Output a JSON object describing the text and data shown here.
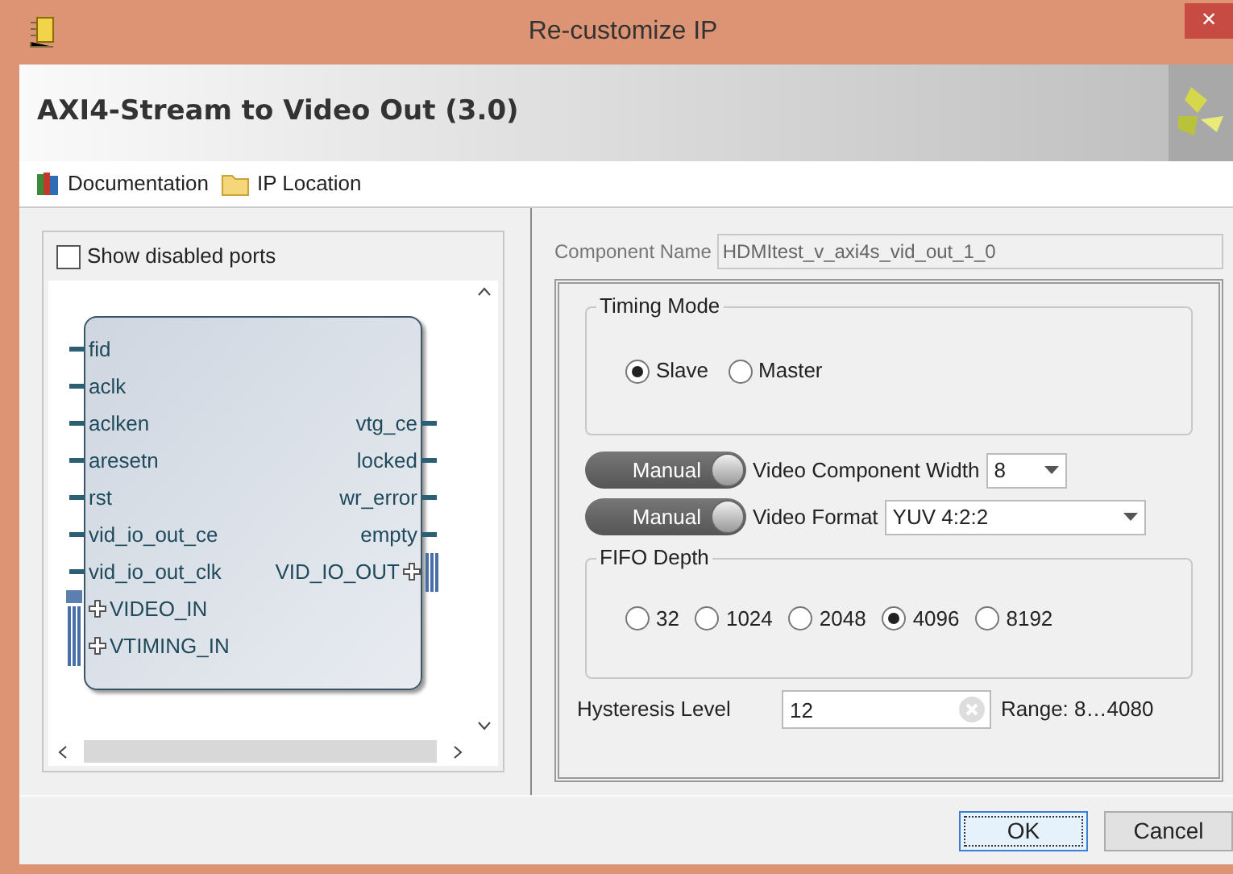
{
  "window": {
    "title": "Re-customize IP",
    "close": "×"
  },
  "header": {
    "title": "AXI4-Stream to Video Out (3.0)"
  },
  "toolbar": [
    {
      "label": "Documentation",
      "kind": "books"
    },
    {
      "label": "IP Location",
      "kind": "folder"
    }
  ],
  "left_panel": {
    "show_disabled_ports": {
      "label": "Show disabled ports",
      "checked": false
    },
    "block": {
      "rows": [
        {
          "left": {
            "label": "fid",
            "kind": "wire"
          }
        },
        {
          "left": {
            "label": "aclk",
            "kind": "wire"
          }
        },
        {
          "left": {
            "label": "aclken",
            "kind": "wire"
          },
          "right": {
            "label": "vtg_ce",
            "kind": "wire"
          }
        },
        {
          "left": {
            "label": "aresetn",
            "kind": "wire"
          },
          "right": {
            "label": "locked",
            "kind": "wire"
          }
        },
        {
          "left": {
            "label": "rst",
            "kind": "wire"
          },
          "right": {
            "label": "wr_error",
            "kind": "wire"
          }
        },
        {
          "left": {
            "label": "vid_io_out_ce",
            "kind": "wire"
          },
          "right": {
            "label": "empty",
            "kind": "wire"
          }
        },
        {
          "left": {
            "label": "vid_io_out_clk",
            "kind": "wire"
          },
          "right": {
            "label": "VID_IO_OUT",
            "kind": "bus"
          }
        },
        {
          "left": {
            "label": "VIDEO_IN",
            "kind": "stream"
          }
        },
        {
          "left": {
            "label": "VTIMING_IN",
            "kind": "bus"
          }
        }
      ]
    }
  },
  "right_panel": {
    "component_name": {
      "label": "Component Name",
      "value": "HDMItest_v_axi4s_vid_out_1_0"
    },
    "timing_mode": {
      "title": "Timing Mode",
      "options": [
        {
          "label": "Slave",
          "selected": true
        },
        {
          "label": "Master",
          "selected": false
        }
      ]
    },
    "manual_rows": [
      {
        "toggle": "Manual",
        "label": "Video Component Width",
        "value": "8"
      },
      {
        "toggle": "Manual",
        "label": "Video Format",
        "value": "YUV 4:2:2"
      }
    ],
    "fifo_depth": {
      "title": "FIFO Depth",
      "options": [
        {
          "label": "32",
          "selected": false
        },
        {
          "label": "1024",
          "selected": false
        },
        {
          "label": "2048",
          "selected": false
        },
        {
          "label": "4096",
          "selected": true
        },
        {
          "label": "8192",
          "selected": false
        }
      ]
    },
    "hysteresis": {
      "label": "Hysteresis Level",
      "value": "12",
      "range": "Range: 8…4080"
    }
  },
  "buttons": [
    {
      "label": "OK",
      "focused": true
    },
    {
      "label": "Cancel",
      "focused": false
    }
  ]
}
